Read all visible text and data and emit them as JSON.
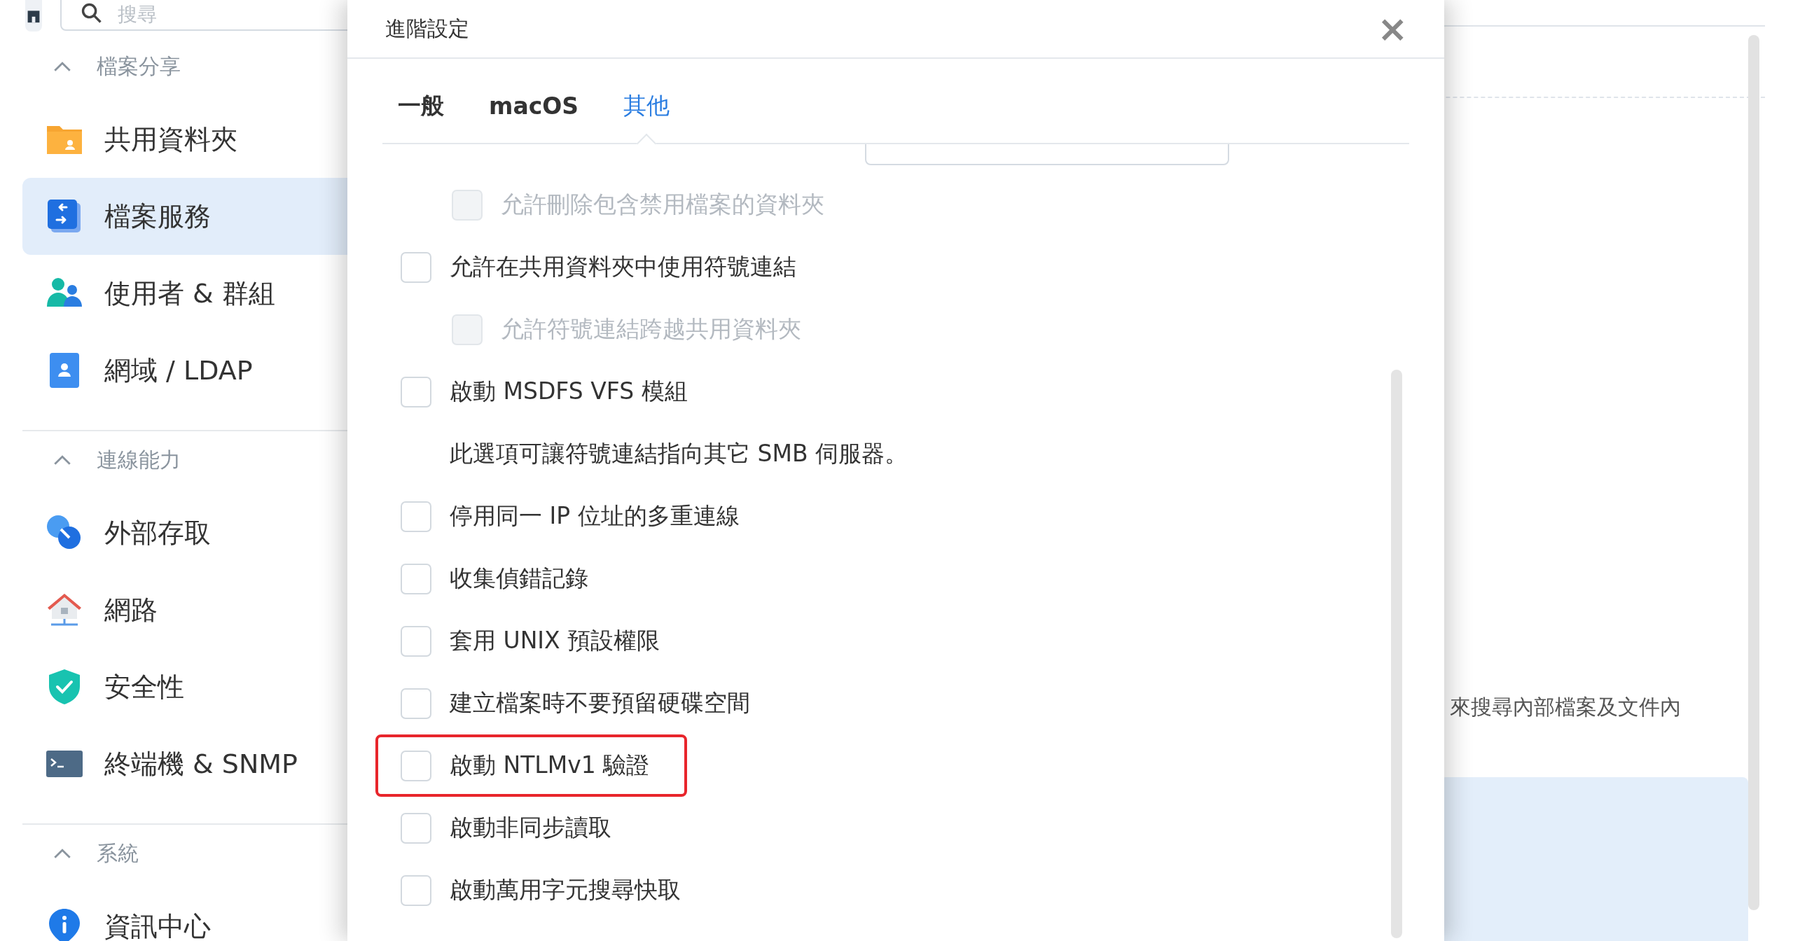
{
  "sidebar": {
    "search": {
      "placeholder": "搜尋"
    },
    "sections": [
      {
        "title": "檔案分享",
        "expanded": true,
        "items": [
          {
            "label": "共用資料夾",
            "selected": false
          },
          {
            "label": "檔案服務",
            "selected": true
          },
          {
            "label": "使用者 & 群組",
            "selected": false
          },
          {
            "label": "網域 / LDAP",
            "selected": false
          }
        ]
      },
      {
        "title": "連線能力",
        "expanded": true,
        "items": [
          {
            "label": "外部存取",
            "selected": false
          },
          {
            "label": "網路",
            "selected": false
          },
          {
            "label": "安全性",
            "selected": false
          },
          {
            "label": "終端機 & SNMP",
            "selected": false
          }
        ]
      },
      {
        "title": "系統",
        "expanded": true,
        "items": [
          {
            "label": "資訊中心",
            "selected": false
          }
        ]
      }
    ]
  },
  "main": {
    "text": "來搜尋內部檔案及文件內"
  },
  "dialog": {
    "title": "進階設定",
    "close": "×",
    "tabs": [
      {
        "label": "一般",
        "selected": false
      },
      {
        "label": "macOS",
        "selected": false
      },
      {
        "label": "其他",
        "selected": true
      }
    ],
    "options": [
      {
        "kind": "dropdown",
        "children": [
          {
            "kind": "checkbox",
            "label": "允許刪除包含禁用檔案的資料夾",
            "checked": false,
            "disabled": true,
            "highlighted": false
          }
        ]
      },
      {
        "kind": "checkbox",
        "label": "允許在共用資料夾中使用符號連結",
        "checked": false,
        "disabled": false,
        "highlighted": false,
        "children": [
          {
            "kind": "checkbox",
            "label": "允許符號連結跨越共用資料夾",
            "checked": false,
            "disabled": true,
            "highlighted": false
          }
        ]
      },
      {
        "kind": "checkbox",
        "label": "啟動 MSDFS VFS 模組",
        "checked": false,
        "disabled": false,
        "highlighted": false
      },
      {
        "kind": "note",
        "label": "此選項可讓符號連結指向其它 SMB 伺服器。"
      },
      {
        "kind": "checkbox",
        "label": "停用同一 IP 位址的多重連線",
        "checked": false,
        "disabled": false,
        "highlighted": false
      },
      {
        "kind": "checkbox",
        "label": "收集偵錯記錄",
        "checked": false,
        "disabled": false,
        "highlighted": false
      },
      {
        "kind": "checkbox",
        "label": "套用 UNIX 預設權限",
        "checked": false,
        "disabled": false,
        "highlighted": false
      },
      {
        "kind": "checkbox",
        "label": "建立檔案時不要預留硬碟空間",
        "checked": false,
        "disabled": false,
        "highlighted": false
      },
      {
        "kind": "checkbox",
        "label": "啟動 NTLMv1 驗證",
        "checked": false,
        "disabled": false,
        "highlighted": true
      },
      {
        "kind": "checkbox",
        "label": "啟動非同步讀取",
        "checked": false,
        "disabled": false,
        "highlighted": false
      },
      {
        "kind": "checkbox",
        "label": "啟動萬用字元搜尋快取",
        "checked": false,
        "disabled": false,
        "highlighted": false
      }
    ]
  }
}
